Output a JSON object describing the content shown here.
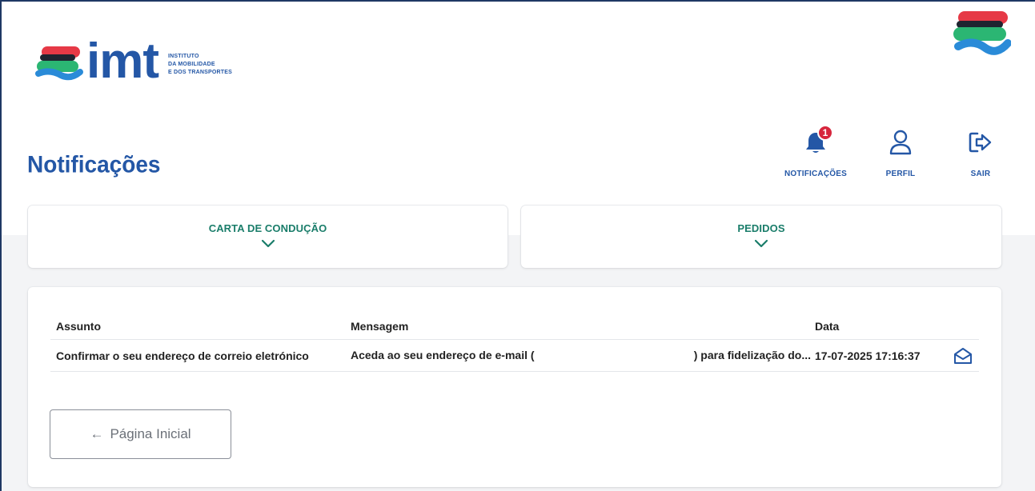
{
  "brand": {
    "name": "imt",
    "tagline": [
      "INSTITUTO",
      "DA MOBILIDADE",
      "E DOS TRANSPORTES"
    ],
    "colors": {
      "red": "#e63946",
      "green": "#2bb673",
      "blue": "#2a8bd8",
      "dark": "#1f2430",
      "navy": "#2457a6",
      "teal": "#1a7d6a"
    }
  },
  "header": {
    "title": "Notificações",
    "nav": [
      {
        "label": "NOTIFICAÇÕES",
        "icon": "bell-icon",
        "badge": "1"
      },
      {
        "label": "PERFIL",
        "icon": "user-icon"
      },
      {
        "label": "SAIR",
        "icon": "logout-icon"
      }
    ]
  },
  "sections": [
    {
      "label": "CARTA DE CONDUÇÃO",
      "icon": "chevron-down-icon"
    },
    {
      "label": "PEDIDOS",
      "icon": "chevron-down-icon"
    }
  ],
  "table": {
    "columns": [
      "Assunto",
      "Mensagem",
      "Data"
    ],
    "rows": [
      {
        "subject": "Confirmar o seu endereço de correio eletrónico",
        "message_start": "Aceda ao seu endereço de e-mail (",
        "message_end": ") para fidelização do...",
        "date": "17-07-2025 17:16:37",
        "icon": "envelope-open-icon"
      }
    ]
  },
  "footer": {
    "home_button": "Página Inicial",
    "home_icon": "arrow-left-icon"
  }
}
